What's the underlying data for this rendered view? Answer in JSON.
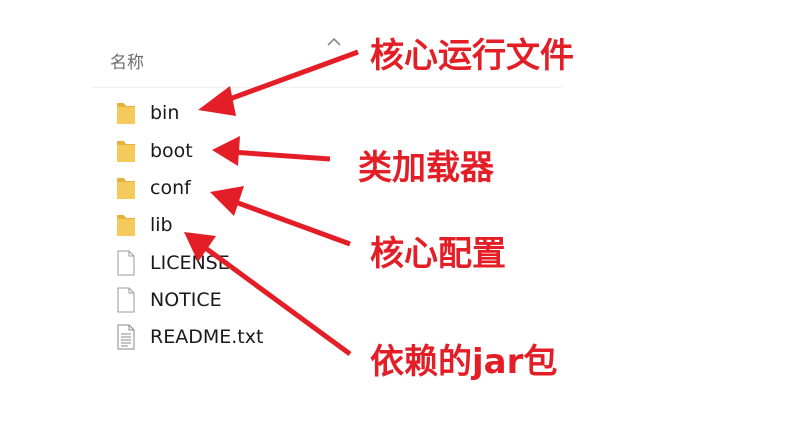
{
  "explorer": {
    "column_header": "名称",
    "sort_icon": "chevron-up-icon",
    "files": [
      {
        "name": "bin",
        "icon": "folder-icon",
        "kind": "folder"
      },
      {
        "name": "boot",
        "icon": "folder-icon",
        "kind": "folder"
      },
      {
        "name": "conf",
        "icon": "folder-icon",
        "kind": "folder"
      },
      {
        "name": "lib",
        "icon": "folder-icon",
        "kind": "folder"
      },
      {
        "name": "LICENSE",
        "icon": "file-icon",
        "kind": "file"
      },
      {
        "name": "NOTICE",
        "icon": "file-icon",
        "kind": "file"
      },
      {
        "name": "README.txt",
        "icon": "text-file-icon",
        "kind": "text-file"
      }
    ]
  },
  "annotations": [
    {
      "text": "核心运行文件",
      "points_to": "bin"
    },
    {
      "text": "类加载器",
      "points_to": "boot"
    },
    {
      "text": "核心配置",
      "points_to": "conf"
    },
    {
      "text": "依赖的jar包",
      "points_to": "lib"
    }
  ],
  "colors": {
    "annotation": "#e41e26",
    "folder": "#f5c95b",
    "folder_dark": "#e6b23a",
    "header_text": "#6e6e6e",
    "file_text": "#1a1a1a"
  }
}
